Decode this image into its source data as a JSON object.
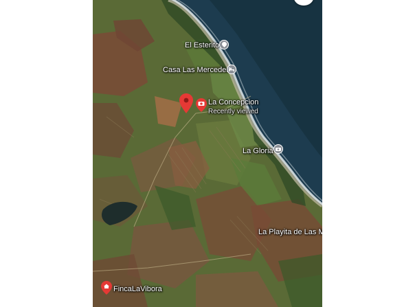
{
  "map": {
    "type": "satellite",
    "colors": {
      "ocean": "#1d3c4f",
      "ocean_deep": "#17323f",
      "surf": "#dfe7ea",
      "beach": "#b8b39a",
      "forest": "#2f4a25",
      "field_green": "#5c7a3a",
      "field_brown": "#7a4a36",
      "field_tan": "#8e7a52",
      "lake": "#1e2d2c",
      "pin_red": "#e53935",
      "poi_gray": "#8a8f96"
    },
    "places": {
      "el_esterito": "El Esterito",
      "casa_las_mercedes": "Casa Las Mercedes",
      "la_concepcion": "La Concepcion",
      "la_concepcion_sub": "Recently viewed",
      "la_gloria": "La Gloria",
      "la_playita": "La Playita de Las Ma",
      "finca_la_vibora": "FincaLaVibora"
    },
    "icons": {
      "el_esterito": "pin-icon",
      "casa_las_mercedes": "hotel-icon",
      "la_concepcion": "camera-icon",
      "la_gloria": "camera-icon",
      "finca_la_vibora": "home-icon",
      "selected": "location-pin-icon",
      "corner": "chevron-down-icon"
    }
  }
}
